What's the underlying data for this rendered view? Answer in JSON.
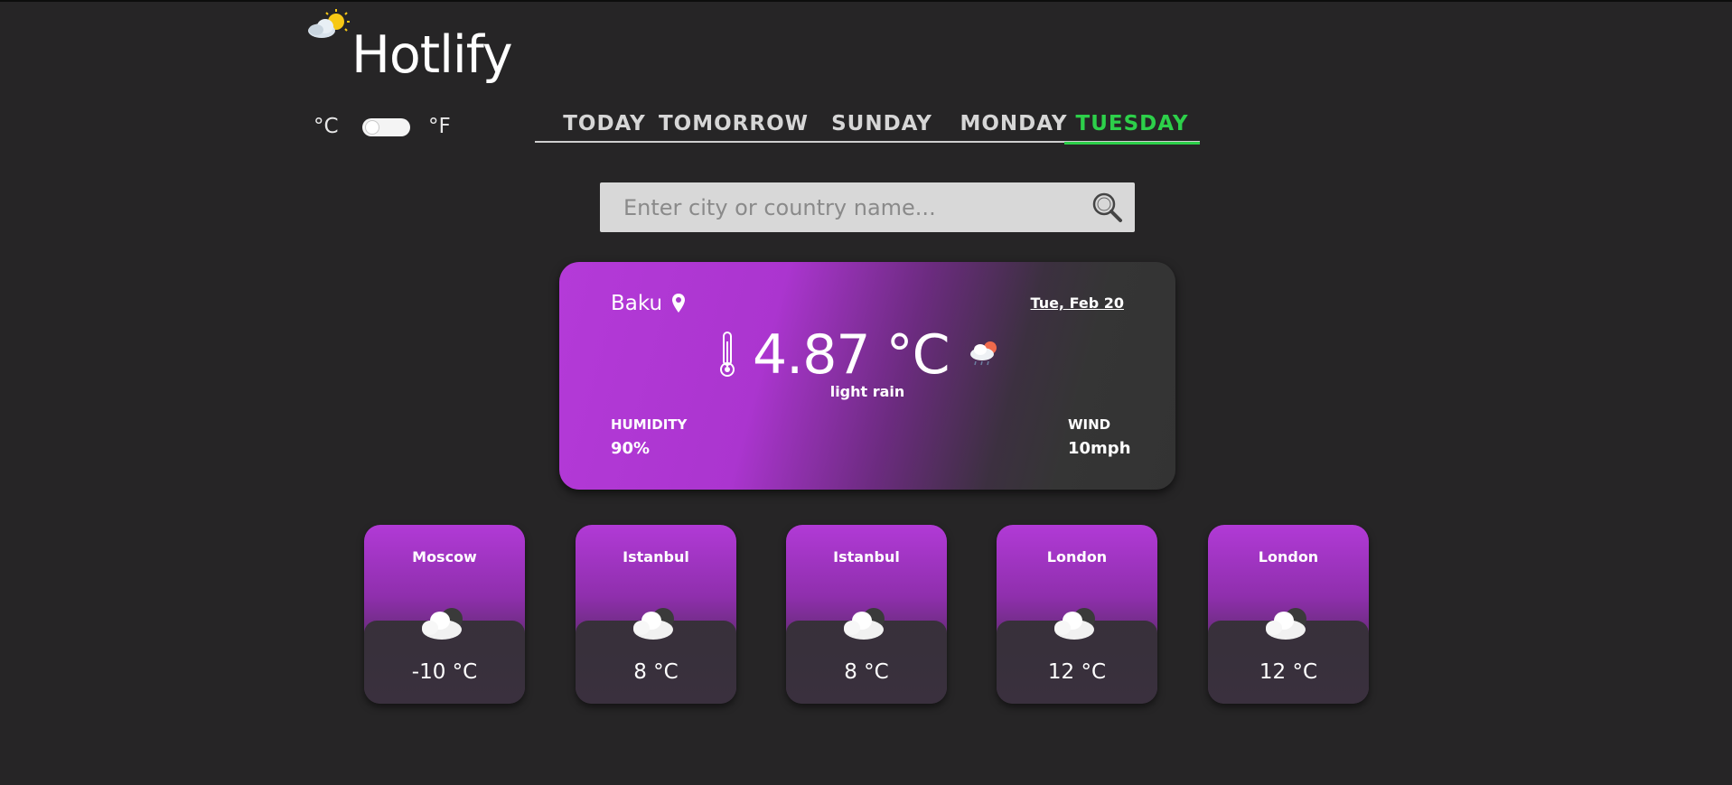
{
  "app": {
    "title": "Hotlify"
  },
  "units": {
    "celsius": "°C",
    "fahrenheit": "°F"
  },
  "tabs": [
    "TODAY",
    "TOMORROW",
    "SUNDAY",
    "MONDAY",
    "TUESDAY"
  ],
  "active_tab": "TUESDAY",
  "search": {
    "placeholder": "Enter city or country name..."
  },
  "current": {
    "city": "Baku",
    "date": "Tue, Feb 20",
    "temperature": "4.87 °C",
    "condition": "light rain",
    "humidity_label": "HUMIDITY",
    "humidity_value": "90%",
    "wind_label": "WIND",
    "wind_value": "10mph"
  },
  "forecast": [
    {
      "city": "Moscow",
      "temp": "-10 °C"
    },
    {
      "city": "Istanbul",
      "temp": "8 °C"
    },
    {
      "city": "Istanbul",
      "temp": "8 °C"
    },
    {
      "city": "London",
      "temp": "12 °C"
    },
    {
      "city": "London",
      "temp": "12 °C"
    }
  ],
  "colors": {
    "background": "#262526",
    "accent_purple": "#b43ad8",
    "active_tab": "#2dd04a"
  }
}
